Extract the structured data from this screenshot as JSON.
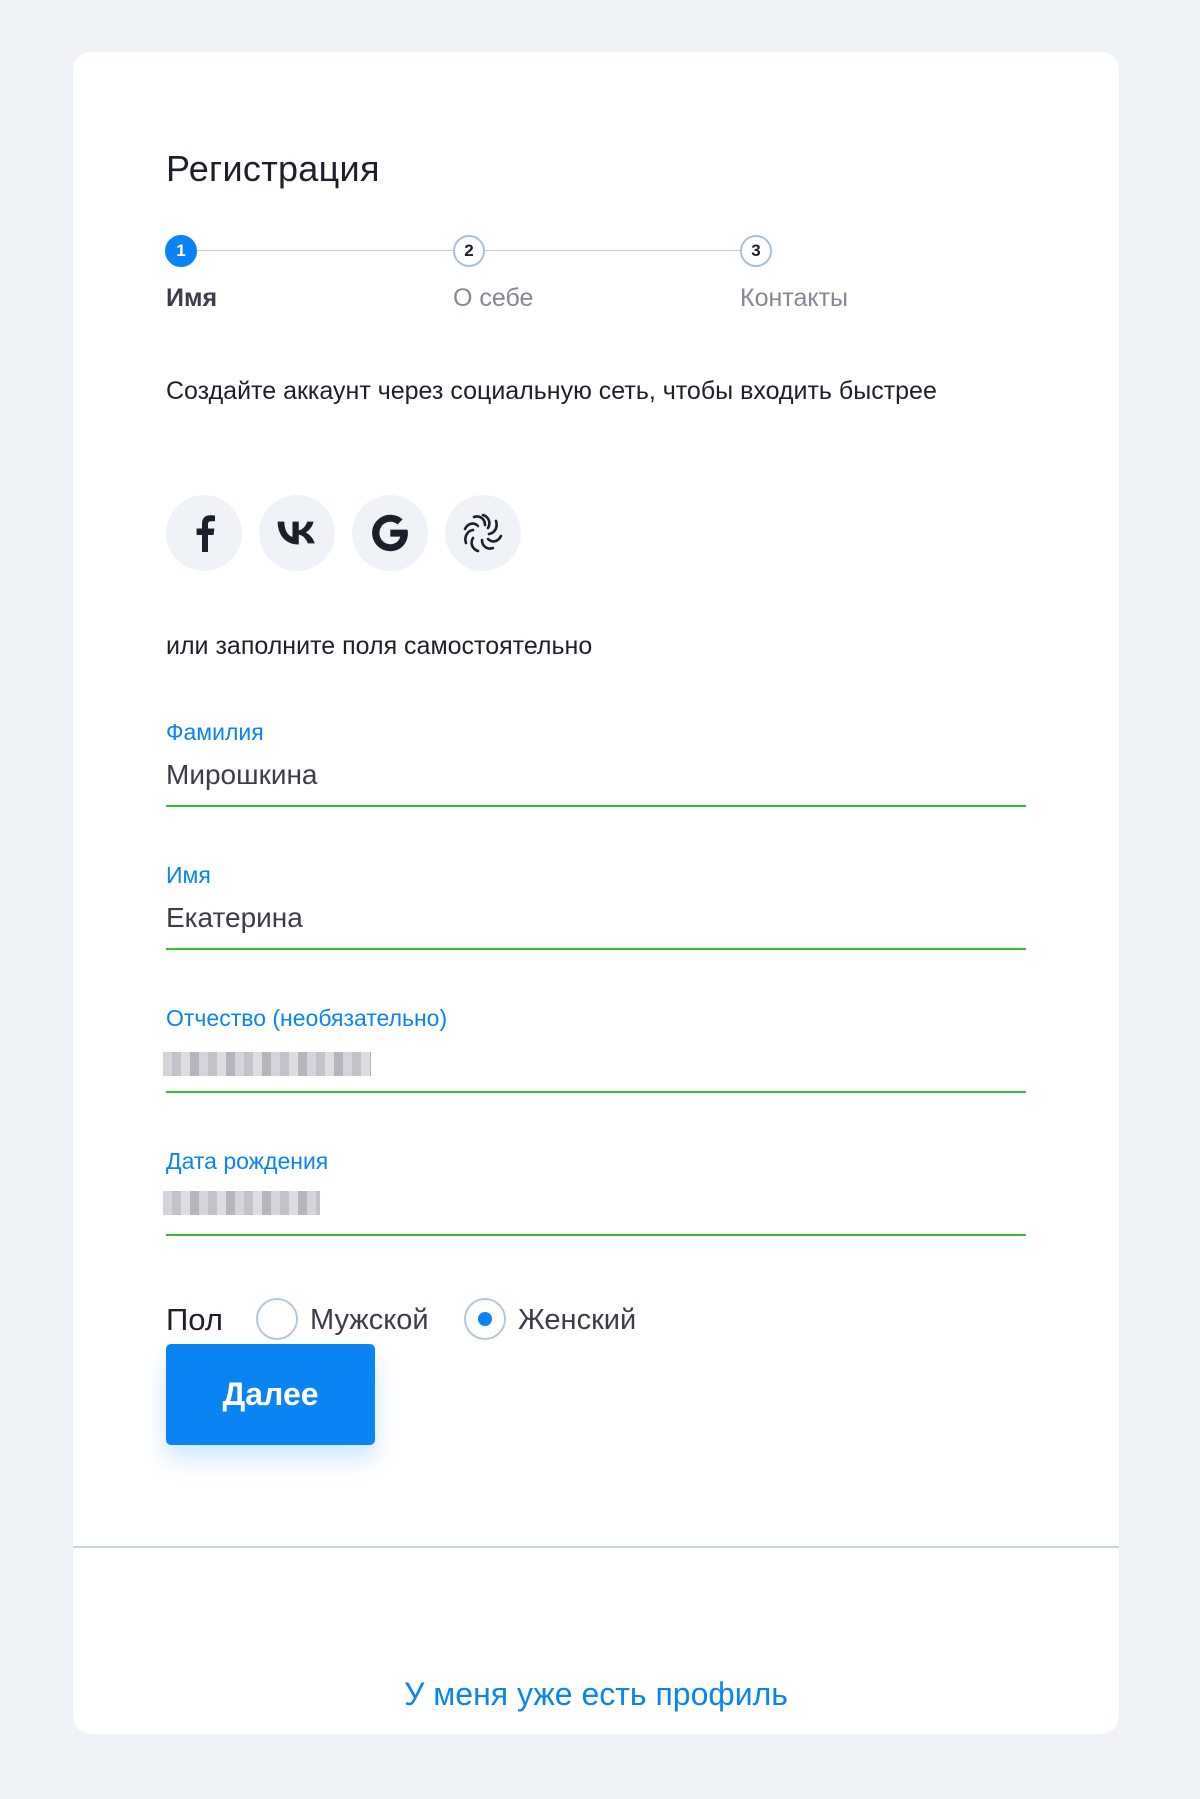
{
  "form": {
    "title": "Регистрация"
  },
  "stepper": {
    "steps": [
      {
        "number": "1",
        "label": "Имя",
        "active": true
      },
      {
        "number": "2",
        "label": "О себе",
        "active": false
      },
      {
        "number": "3",
        "label": "Контакты",
        "active": false
      }
    ]
  },
  "social": {
    "prompt": "Создайте аккаунт через социальную сеть, чтобы входить быстрее",
    "providers": [
      "facebook-icon",
      "vk-icon",
      "google-icon",
      "sber-icon"
    ]
  },
  "manual": {
    "prompt": "или заполните поля самостоятельно"
  },
  "fields": {
    "last_name": {
      "label": "Фамилия",
      "value": "Мирошкина"
    },
    "first_name": {
      "label": "Имя",
      "value": "Екатерина"
    },
    "patronymic": {
      "label": "Отчество (необязательно)",
      "value_redacted": true
    },
    "birth_date": {
      "label": "Дата рождения",
      "value_redacted": true
    }
  },
  "gender": {
    "label": "Пол",
    "options": [
      {
        "label": "Мужской",
        "checked": false
      },
      {
        "label": "Женский",
        "checked": true
      }
    ]
  },
  "actions": {
    "next_label": "Далее",
    "login_link": "У меня уже есть профиль"
  },
  "colors": {
    "accent": "#0a84f2",
    "valid": "#2ec02f",
    "background": "#eff2f7"
  }
}
